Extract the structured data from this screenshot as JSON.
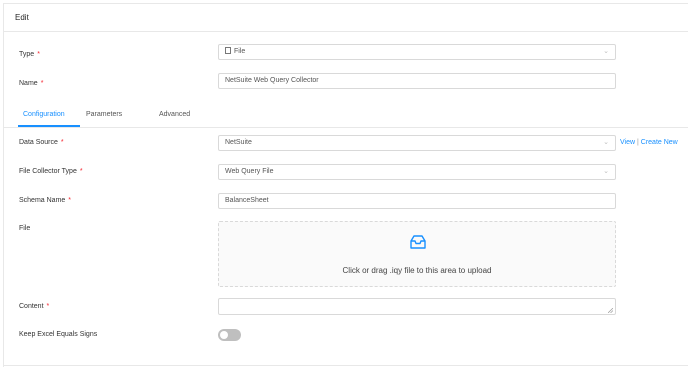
{
  "header": {
    "title": "Edit"
  },
  "fields": {
    "type": {
      "label": "Type",
      "value": "File",
      "icon": "file-icon"
    },
    "name": {
      "label": "Name",
      "value": "NetSuite Web Query Collector"
    },
    "data_source": {
      "label": "Data Source",
      "value": "NetSuite"
    },
    "file_collector_type": {
      "label": "File Collector Type",
      "value": "Web Query File"
    },
    "schema_name": {
      "label": "Schema Name",
      "value": "BalanceSheet"
    },
    "file": {
      "label": "File",
      "upload_text": "Click or drag .iqy file to this area to upload",
      "icon": "inbox-icon"
    },
    "content": {
      "label": "Content",
      "value": ""
    },
    "keep_excel": {
      "label": "Keep Excel Equals Signs",
      "checked": false
    }
  },
  "required_mark": "*",
  "tabs": [
    {
      "label": "Configuration",
      "active": true
    },
    {
      "label": "Parameters",
      "active": false
    },
    {
      "label": "Advanced",
      "active": false
    }
  ],
  "links": {
    "view": "View",
    "separator": "|",
    "create_new": "Create New"
  },
  "colors": {
    "accent": "#1890ff",
    "required": "#f5222d"
  }
}
